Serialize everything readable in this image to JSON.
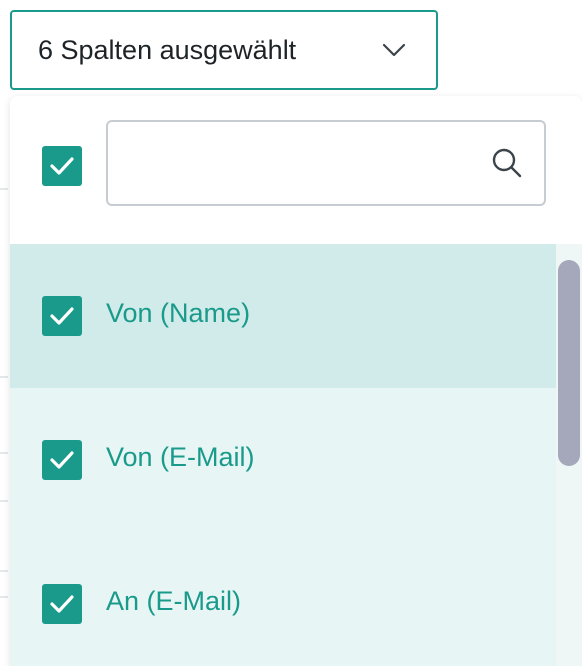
{
  "trigger": {
    "label": "6 Spalten ausgewählt",
    "icon": "chevron-down-icon"
  },
  "dropdown": {
    "select_all_checked": true,
    "search": {
      "value": "",
      "placeholder": "",
      "icon": "search-icon"
    },
    "items": [
      {
        "label": "Von (Name)",
        "checked": true
      },
      {
        "label": "Von (E-Mail)",
        "checked": true
      },
      {
        "label": "An (E-Mail)",
        "checked": true
      }
    ]
  },
  "colors": {
    "accent": "#1a9a8a",
    "row_active_bg": "#d0ebea",
    "row_bg": "#e7f6f5",
    "text": "#1d2327",
    "search_border": "#c6ccd2",
    "scrollbar_thumb": "#a5a7ba"
  }
}
